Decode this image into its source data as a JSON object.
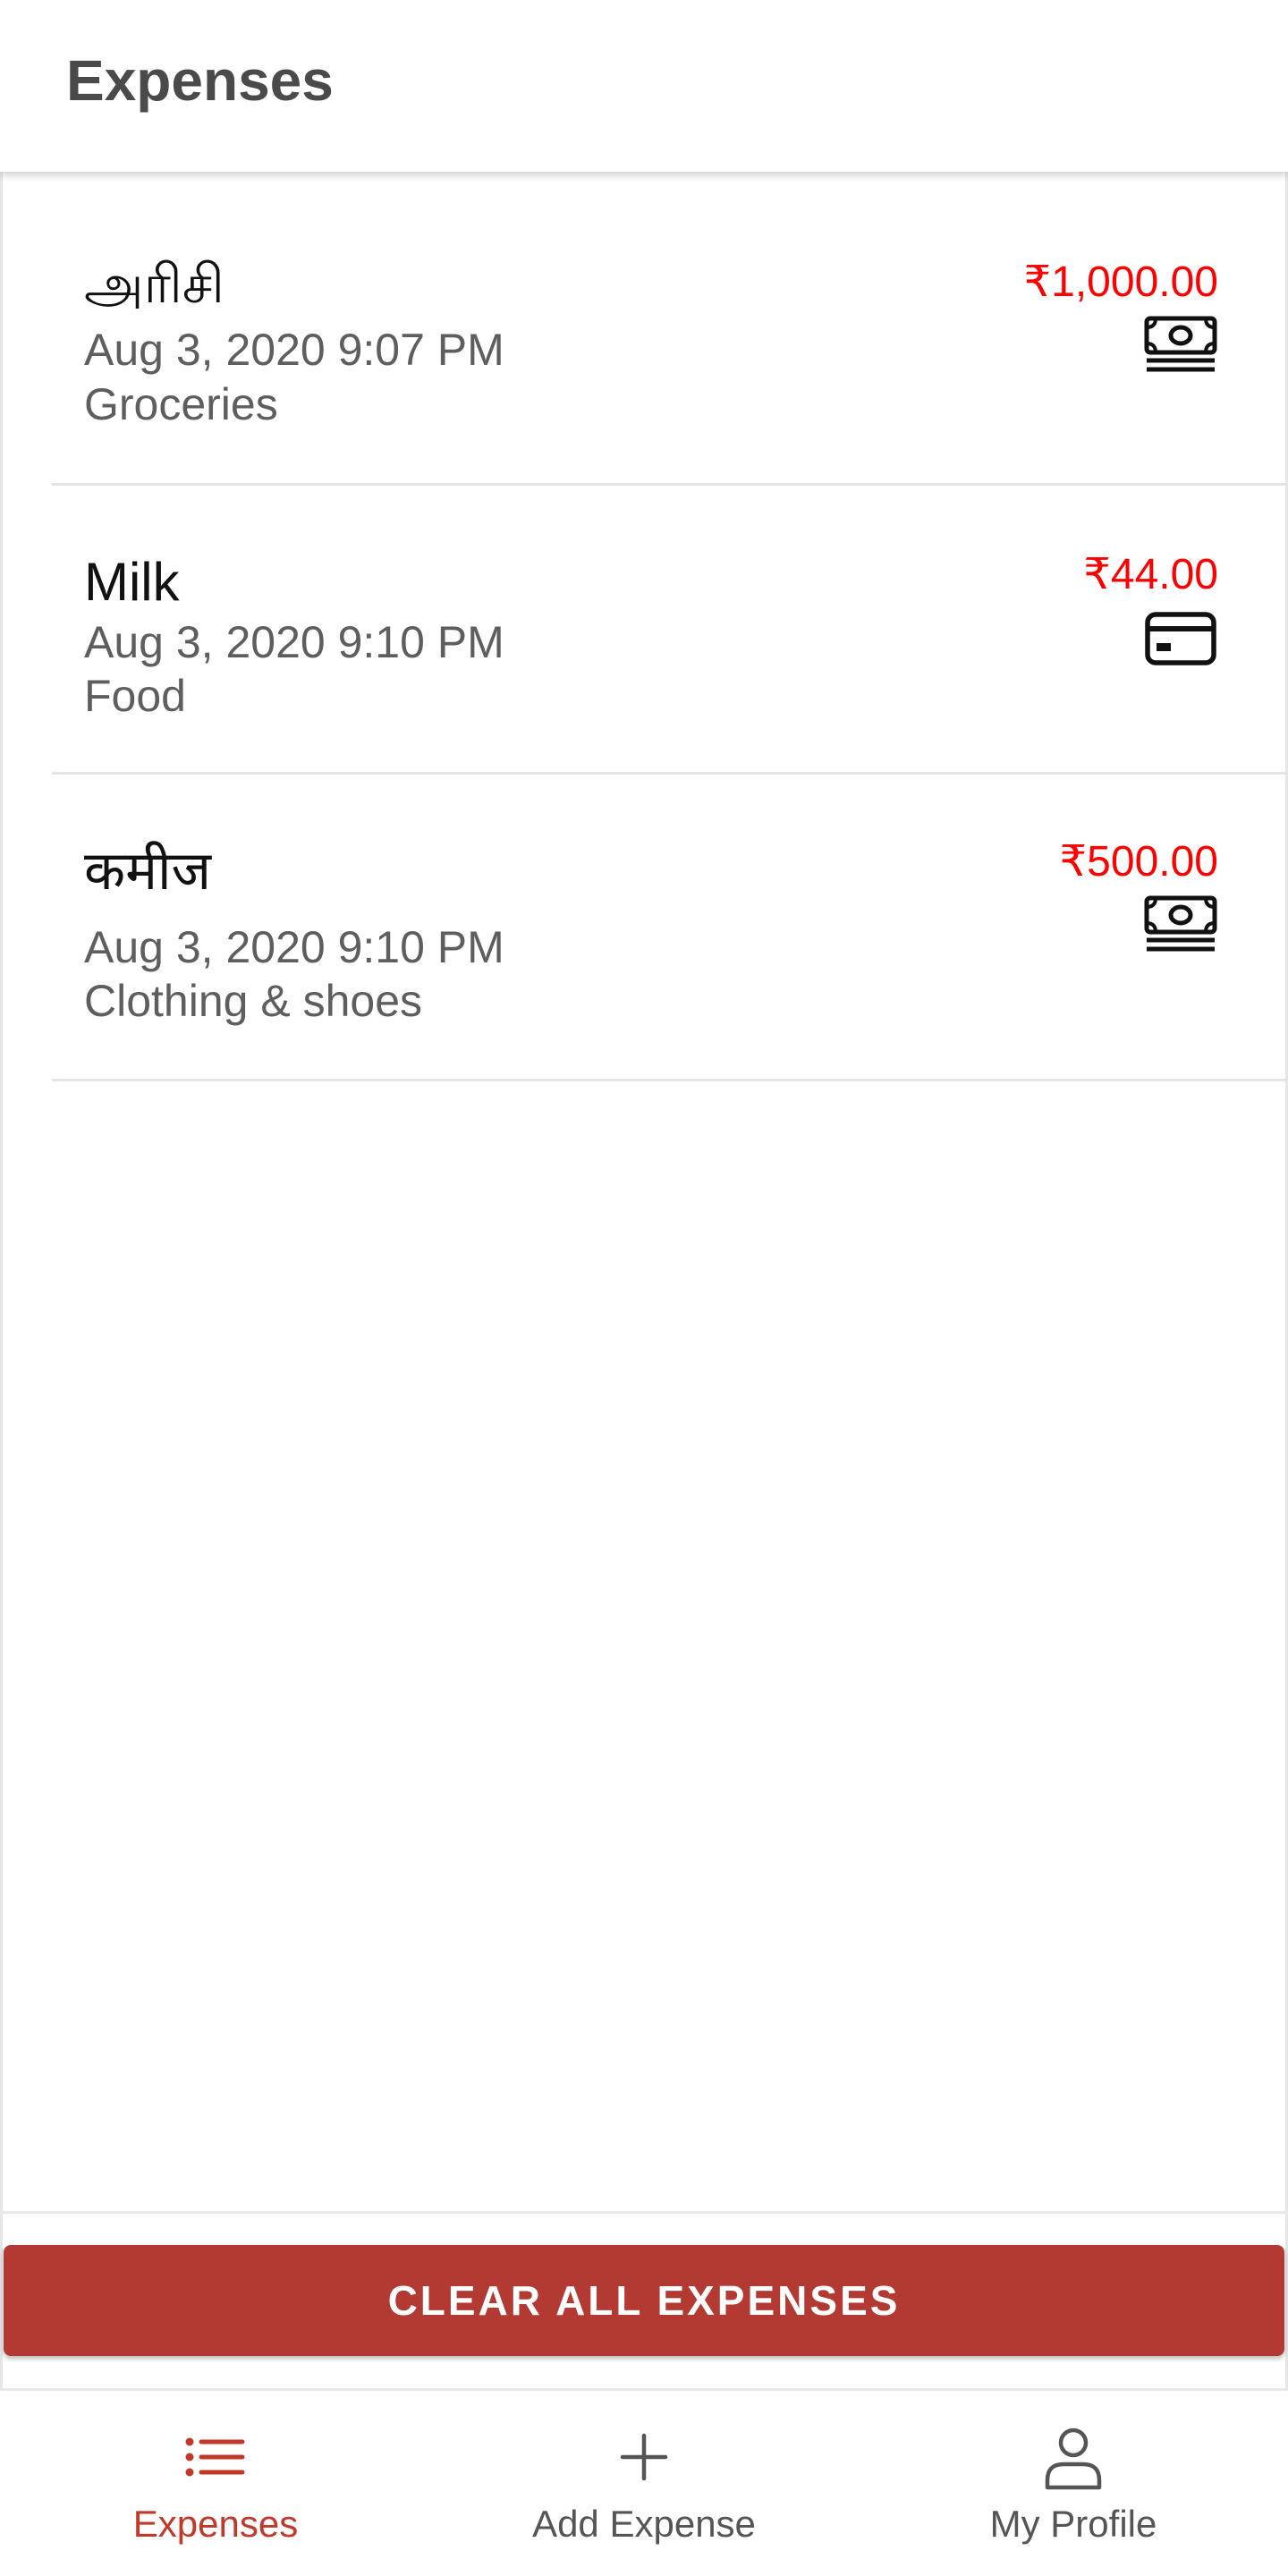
{
  "header": {
    "title": "Expenses"
  },
  "expenses": [
    {
      "name": "அரிசி",
      "date": "Aug 3, 2020 9:07 PM",
      "category": "Groceries",
      "amount": "₹1,000.00",
      "payment_icon": "cash-icon"
    },
    {
      "name": "Milk",
      "date": "Aug 3, 2020 9:10 PM",
      "category": "Food",
      "amount": "₹44.00",
      "payment_icon": "card-icon"
    },
    {
      "name": "कमीज",
      "date": "Aug 3, 2020 9:10 PM",
      "category": "Clothing & shoes",
      "amount": "₹500.00",
      "payment_icon": "cash-icon"
    }
  ],
  "actions": {
    "clear_all_label": "CLEAR ALL EXPENSES"
  },
  "tabbar": {
    "tabs": [
      {
        "label": "Expenses",
        "icon": "list-icon",
        "active": true
      },
      {
        "label": "Add Expense",
        "icon": "plus-icon",
        "active": false
      },
      {
        "label": "My Profile",
        "icon": "person-icon",
        "active": false
      }
    ]
  },
  "colors": {
    "accent": "#b23a32",
    "active_tab": "#c0392b",
    "amount": "#ff0000",
    "header_text": "#4a4a4a"
  }
}
